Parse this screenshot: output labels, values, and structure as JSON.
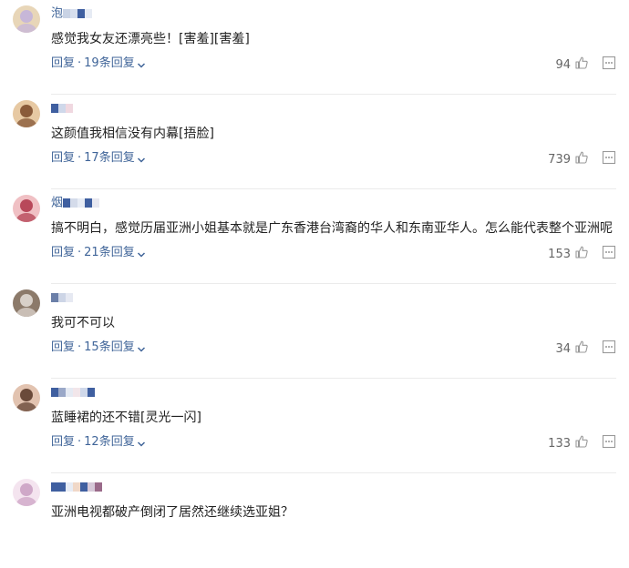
{
  "comments": [
    {
      "username": "泡",
      "text": "感觉我女友还漂亮些！[害羞][害羞]",
      "reply_label": "回复",
      "reply_count": "19条回复",
      "likes": "94",
      "avatar_colors": [
        "#c7b7d8",
        "#e8d6b8"
      ]
    },
    {
      "username": "",
      "text": "这颜值我相信没有内幕[捂脸]",
      "reply_label": "回复",
      "reply_count": "17条回复",
      "likes": "739",
      "avatar_colors": [
        "#8a5b3a",
        "#e7c9a3"
      ]
    },
    {
      "username": "烟",
      "text": "搞不明白，感觉历届亚洲小姐基本就是广东香港台湾裔的华人和东南亚华人。怎么能代表整个亚洲呢",
      "reply_label": "回复",
      "reply_count": "21条回复",
      "likes": "153",
      "avatar_colors": [
        "#b8485a",
        "#f0c0c4"
      ]
    },
    {
      "username": "",
      "text": "我可不可以",
      "reply_label": "回复",
      "reply_count": "15条回复",
      "likes": "34",
      "avatar_colors": [
        "#d8d0c8",
        "#8c7a6a"
      ]
    },
    {
      "username": "",
      "text": "蓝睡裙的还不错[灵光一闪]",
      "reply_label": "回复",
      "reply_count": "12条回复",
      "likes": "133",
      "avatar_colors": [
        "#6a4a3a",
        "#e2c3b0"
      ]
    },
    {
      "username": "",
      "text": "亚洲电视都破产倒闭了居然还继续选亚姐？",
      "reply_label": "",
      "reply_count": "",
      "likes": "",
      "avatar_colors": [
        "#cfa8c8",
        "#f4e4ef"
      ]
    }
  ],
  "colors": {
    "link": "#406599",
    "divider": "#ebebeb"
  },
  "icons": {
    "chevron": "chevron-down-icon",
    "like": "thumbs-up-icon",
    "more": "more-icon"
  }
}
